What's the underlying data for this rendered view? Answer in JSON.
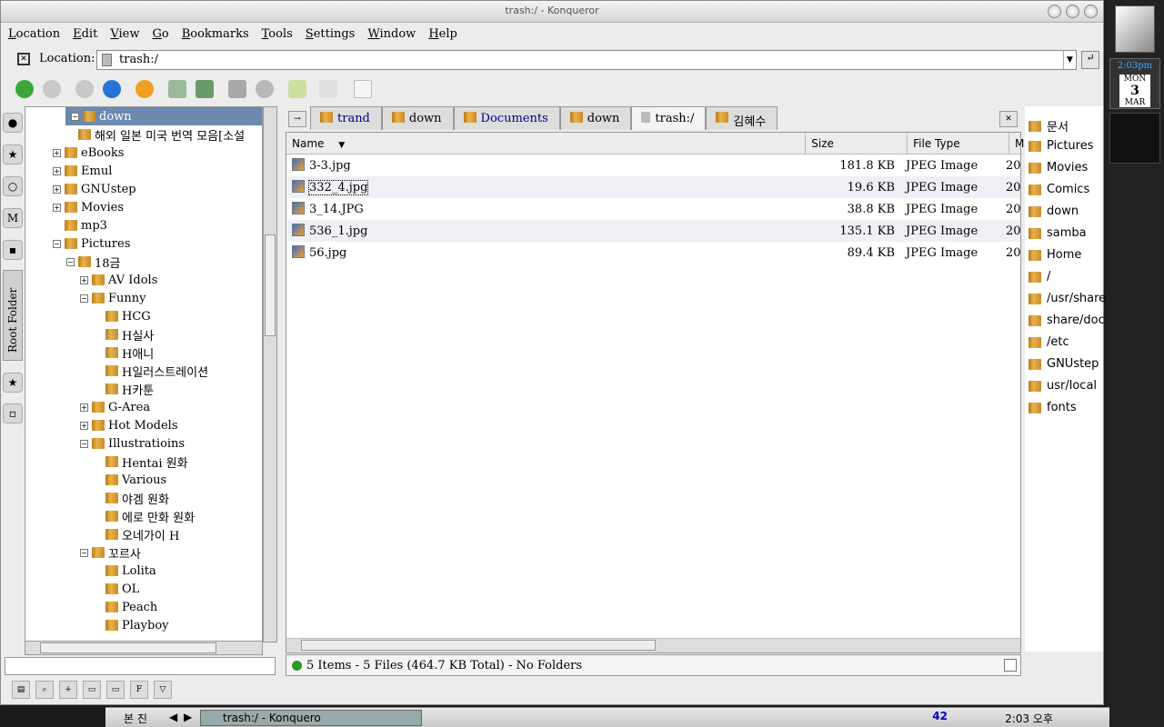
{
  "window": {
    "title": "trash:/ - Konqueror"
  },
  "menu": [
    "Location",
    "Edit",
    "View",
    "Go",
    "Bookmarks",
    "Tools",
    "Settings",
    "Window",
    "Help"
  ],
  "location": {
    "label": "Location:",
    "value": "trash:/"
  },
  "tree": [
    {
      "label": "down",
      "indent": 0,
      "expander": "-",
      "selected": true
    },
    {
      "label": "해외 일본 미국 번역 모음[소설",
      "indent": 1,
      "expander": ""
    },
    {
      "label": "eBooks",
      "indent": 0,
      "expander": "+"
    },
    {
      "label": "Emul",
      "indent": 0,
      "expander": "+"
    },
    {
      "label": "GNUstep",
      "indent": 0,
      "expander": "+"
    },
    {
      "label": "Movies",
      "indent": 0,
      "expander": "+"
    },
    {
      "label": "mp3",
      "indent": 0,
      "expander": ""
    },
    {
      "label": "Pictures",
      "indent": 0,
      "expander": "-"
    },
    {
      "label": "18금",
      "indent": 1,
      "expander": "-"
    },
    {
      "label": "AV Idols",
      "indent": 2,
      "expander": "+"
    },
    {
      "label": "Funny",
      "indent": 2,
      "expander": "-"
    },
    {
      "label": "HCG",
      "indent": 3,
      "expander": ""
    },
    {
      "label": "H실사",
      "indent": 3,
      "expander": ""
    },
    {
      "label": "H애니",
      "indent": 3,
      "expander": ""
    },
    {
      "label": "H일러스트레이션",
      "indent": 3,
      "expander": ""
    },
    {
      "label": "H카툰",
      "indent": 3,
      "expander": ""
    },
    {
      "label": "G-Area",
      "indent": 2,
      "expander": "+"
    },
    {
      "label": "Hot Models",
      "indent": 2,
      "expander": "+"
    },
    {
      "label": "Illustratioins",
      "indent": 2,
      "expander": "-"
    },
    {
      "label": "Hentai 원화",
      "indent": 3,
      "expander": ""
    },
    {
      "label": "Various",
      "indent": 3,
      "expander": ""
    },
    {
      "label": "야겜 원화",
      "indent": 3,
      "expander": ""
    },
    {
      "label": "에로 만화 원화",
      "indent": 3,
      "expander": ""
    },
    {
      "label": "오네가이 H",
      "indent": 3,
      "expander": ""
    },
    {
      "label": "꼬르사",
      "indent": 2,
      "expander": "-"
    },
    {
      "label": "Lolita",
      "indent": 3,
      "expander": ""
    },
    {
      "label": "OL",
      "indent": 3,
      "expander": ""
    },
    {
      "label": "Peach",
      "indent": 3,
      "expander": ""
    },
    {
      "label": "Playboy",
      "indent": 3,
      "expander": ""
    }
  ],
  "sidebar_tab": "Root Folder",
  "tabs": [
    {
      "label": "trand",
      "style": "link"
    },
    {
      "label": "down",
      "style": "plain"
    },
    {
      "label": "Documents",
      "style": "link"
    },
    {
      "label": "down",
      "style": "plain"
    },
    {
      "label": "trash:/",
      "style": "active"
    },
    {
      "label": "김혜수",
      "style": "plain"
    }
  ],
  "columns": {
    "name": "Name",
    "size": "Size",
    "type": "File Type",
    "more": "M"
  },
  "files": [
    {
      "name": "3-3.jpg",
      "size": "181.8 KB",
      "type": "JPEG Image",
      "more": "20"
    },
    {
      "name": "332_4.jpg",
      "size": "19.6 KB",
      "type": "JPEG Image",
      "more": "20"
    },
    {
      "name": "3_14.JPG",
      "size": "38.8 KB",
      "type": "JPEG Image",
      "more": "20"
    },
    {
      "name": "536_1.jpg",
      "size": "135.1 KB",
      "type": "JPEG Image",
      "more": "20"
    },
    {
      "name": "56.jpg",
      "size": "89.4 KB",
      "type": "JPEG Image",
      "more": "20"
    }
  ],
  "status": "5 Items - 5 Files (464.7 KB Total) - No Folders",
  "right_panel": [
    "문서",
    "Pictures",
    "Movies",
    "Comics",
    "down",
    "samba",
    "Home",
    "/",
    "/usr/share",
    "share/doc",
    "/etc",
    "GNUstep",
    "usr/local",
    "fonts"
  ],
  "dock": {
    "time": "2:03pm",
    "day": "MON",
    "date": "3",
    "month": "MAR"
  },
  "taskbar": {
    "desktop": "본  진",
    "task": "trash:/ - Konquero",
    "count": "42",
    "clock": "2:03 오후"
  }
}
